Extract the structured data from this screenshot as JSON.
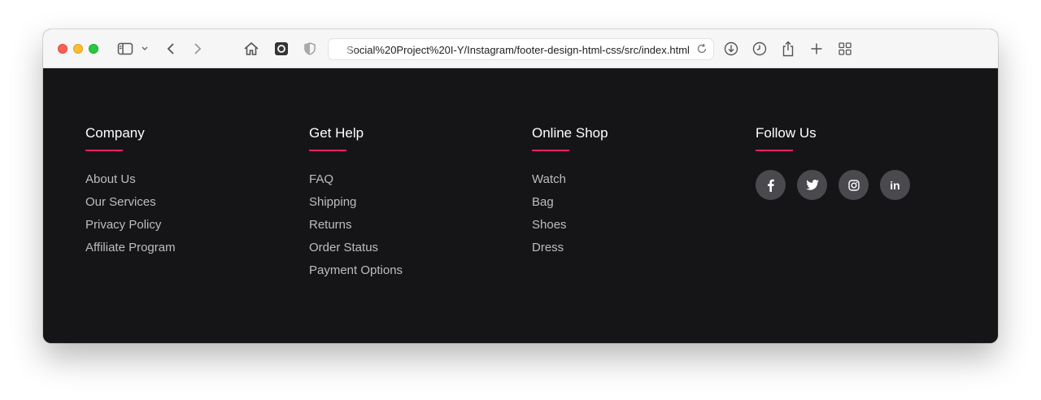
{
  "browser": {
    "url": "Social%20Project%20I-Y/Instagram/footer-design-html-css/src/index.html"
  },
  "footer": {
    "columns": [
      {
        "title": "Company",
        "links": [
          "About Us",
          "Our Services",
          "Privacy Policy",
          "Affiliate Program"
        ]
      },
      {
        "title": "Get Help",
        "links": [
          "FAQ",
          "Shipping",
          "Returns",
          "Order Status",
          "Payment Options"
        ]
      },
      {
        "title": "Online Shop",
        "links": [
          "Watch",
          "Bag",
          "Shoes",
          "Dress"
        ]
      }
    ],
    "follow": {
      "title": "Follow Us",
      "social": [
        {
          "icon": "facebook-icon"
        },
        {
          "icon": "twitter-icon"
        },
        {
          "icon": "instagram-icon"
        },
        {
          "icon": "linkedin-icon",
          "text": "in"
        }
      ]
    }
  },
  "colors": {
    "background": "#151518",
    "accent": "#e91e63",
    "link": "#bdbdbd",
    "social_bg": "#4a4a4e"
  }
}
